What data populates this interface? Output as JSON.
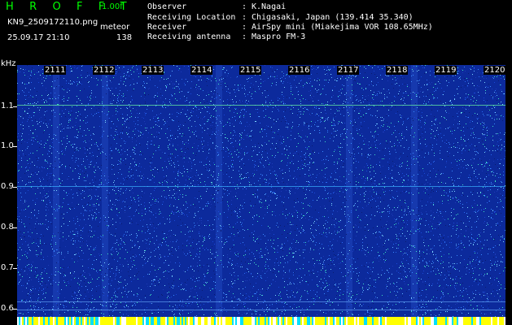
{
  "header": {
    "logo": "H R O F F T",
    "version": "1.00f",
    "filename": "KN9_2509172110.png",
    "timestamp": "25.09.17 21:10",
    "meteor_label": "meteor",
    "meteor_count": "138"
  },
  "info": [
    {
      "key": "Observer",
      "value": "K.Nagai"
    },
    {
      "key": "Receiving Location",
      "value": "Chigasaki, Japan (139.414 35.340)"
    },
    {
      "key": "Receiver",
      "value": "AirSpy mini (Miakejima VOR 108.65MHz)"
    },
    {
      "key": "Receiving antenna",
      "value": "Maspro FM-3"
    }
  ],
  "separator": ":",
  "y_unit": "kHz",
  "y_ticks": [
    "1.1",
    "1.0",
    "0.9",
    "0.8",
    "0.7",
    "0.6"
  ],
  "x_ticks": [
    "2111",
    "2112",
    "2113",
    "2114",
    "2115",
    "2116",
    "2117",
    "2118",
    "2119",
    "2120"
  ],
  "colors": {
    "background": "#000000",
    "noise_base": "#0c2a9c",
    "logo": "#00ff00",
    "line": "#3ab0ff",
    "bottom_bar": "#ffff00"
  }
}
